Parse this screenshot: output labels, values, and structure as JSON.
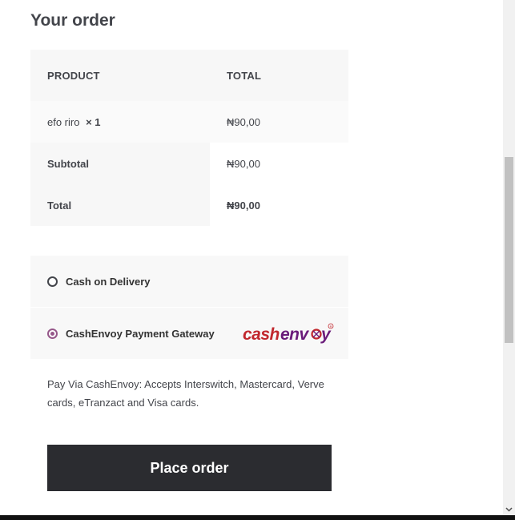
{
  "order": {
    "title": "Your order",
    "headers": {
      "product": "PRODUCT",
      "total": "TOTAL"
    },
    "item": {
      "name": "efo riro",
      "qty": "× 1",
      "total": "₦90,00"
    },
    "subtotal": {
      "label": "Subtotal",
      "value": "₦90,00"
    },
    "total": {
      "label": "Total",
      "value": "₦90,00"
    }
  },
  "payment": {
    "methods": [
      {
        "label": "Cash on Delivery",
        "selected": false
      },
      {
        "label": "CashEnvoy Payment Gateway",
        "selected": true,
        "logo_text": "cashenvoy"
      }
    ],
    "description": "Pay Via CashEnvoy: Accepts Interswitch, Mastercard, Verve cards, eTranzact and Visa cards.",
    "place_order_label": "Place order"
  },
  "colors": {
    "accent": "#96588a",
    "button_bg": "#2b2c30",
    "logo_red": "#c1272d",
    "logo_purple": "#6a1b7a"
  }
}
